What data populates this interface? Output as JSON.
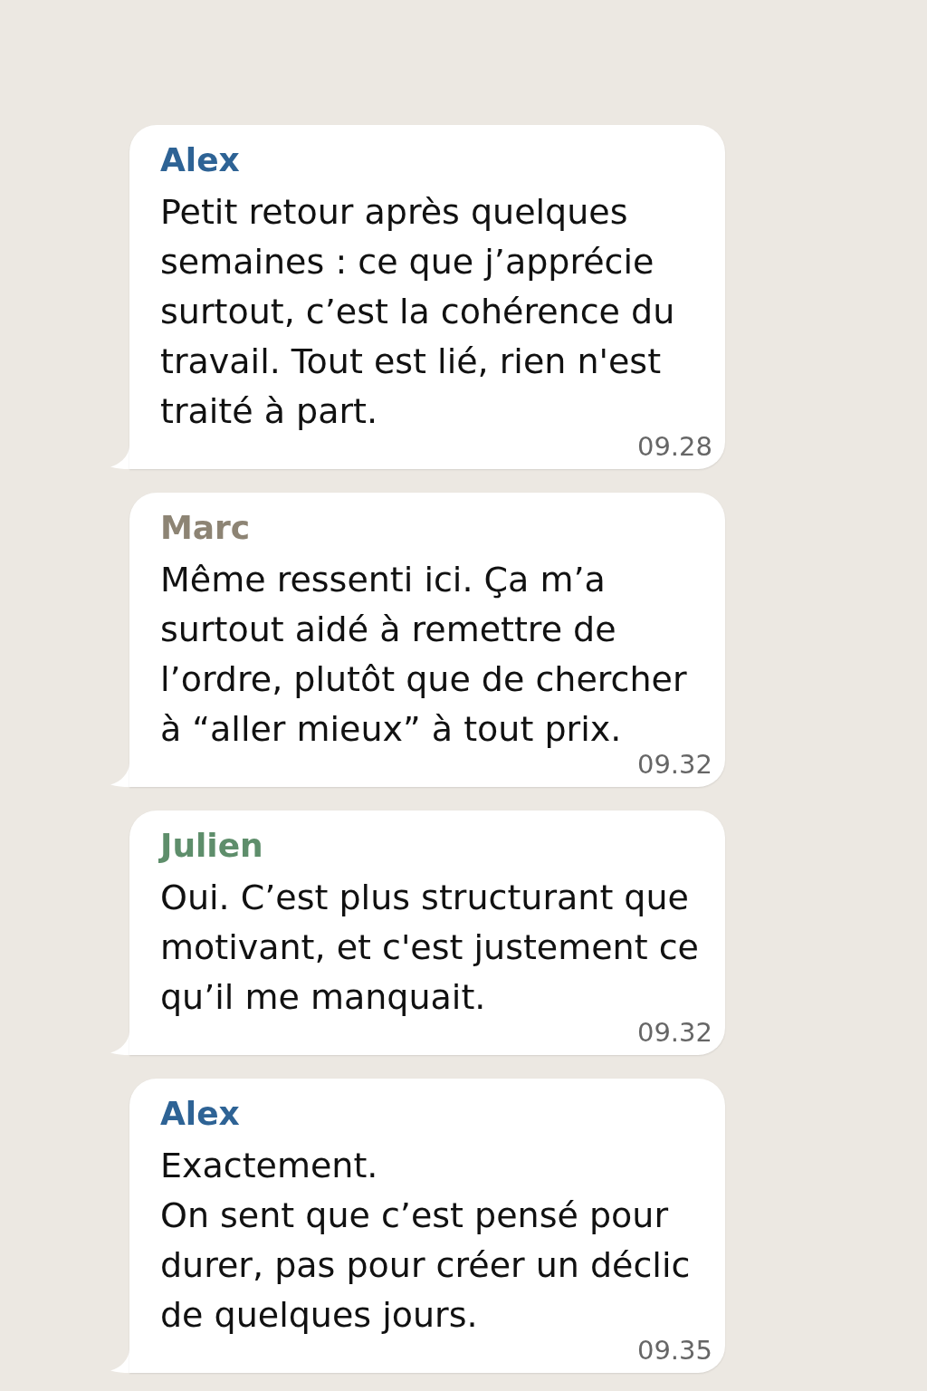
{
  "messages": [
    {
      "sender": "Alex",
      "color": "#2e6395",
      "text": "Petit retour après quelques semaines : ce que j’apprécie surtout, c’est la cohérence du travail. Tout est lié, rien n'est traité à part.",
      "time": "09.28"
    },
    {
      "sender": "Marc",
      "color": "#8d8474",
      "text": "Même ressenti ici. Ça m’a surtout aidé à remettre de l’ordre, plutôt que de chercher à “aller mieux” à tout prix.",
      "time": "09.32"
    },
    {
      "sender": "Julien",
      "color": "#5e8e6b",
      "text": "Oui. C’est plus structurant que motivant, et c'est justement ce qu’il me manquait.",
      "time": "09.32"
    },
    {
      "sender": "Alex",
      "color": "#2e6395",
      "text": "Exactement.\nOn sent que c’est pensé pour durer, pas pour créer un déclic de quelques jours.",
      "time": "09.35"
    }
  ]
}
